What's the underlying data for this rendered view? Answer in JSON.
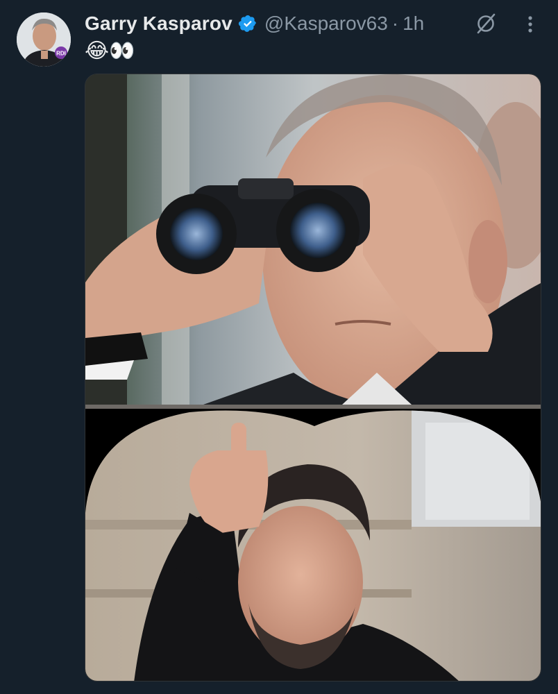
{
  "tweet": {
    "author_name": "Garry Kasparov",
    "handle": "@Kasparov63",
    "separator": "·",
    "time": "1h",
    "text": "😂👀",
    "avatar_badge": "RDI"
  },
  "icons": {
    "verified": "verified-badge-icon",
    "grok": "grok-icon",
    "more": "more-options-icon"
  },
  "colors": {
    "background": "#15202b",
    "verified_blue": "#1d9bf0",
    "secondary_text": "#8b98a5",
    "primary_text": "#e7e9ea"
  }
}
